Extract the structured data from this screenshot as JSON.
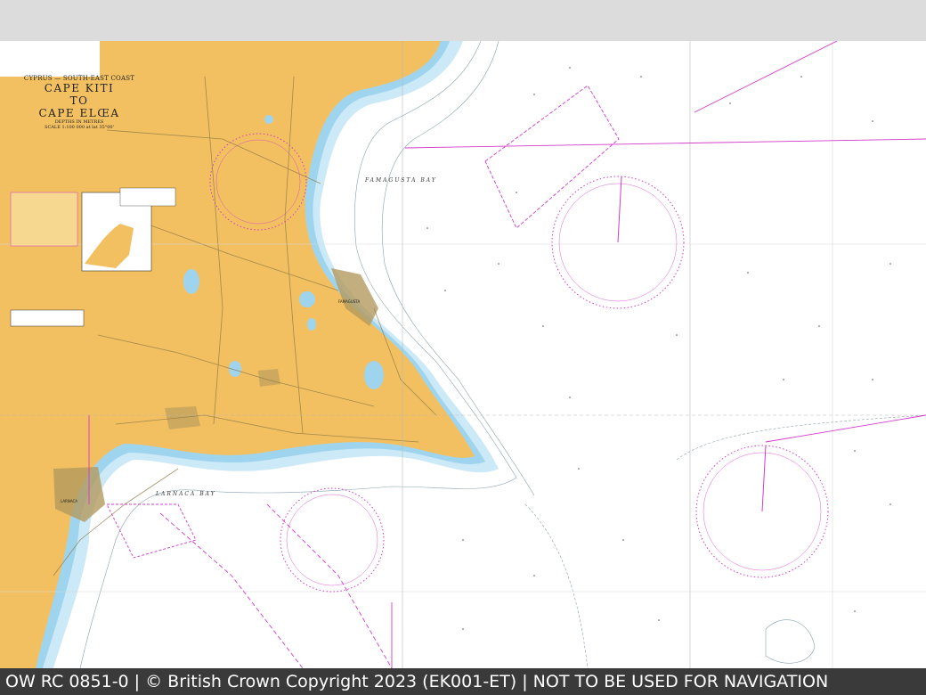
{
  "chart": {
    "region": "CYPRUS — SOUTH-EAST COAST",
    "title_line1": "CAPE KITI",
    "title_line2": "TO",
    "title_line3": "CAPE ELŒA",
    "depth_note": "DEPTHS IN METRES",
    "scale_note": "SCALE 1:100 000 at lat 35°00'"
  },
  "labels": {
    "famagusta_bay": "FAMAGUSTA  BAY",
    "larnaca_bay": "LARNACA  BAY",
    "famagusta": "FAMAGUSTA",
    "larnaca": "LARNACA"
  },
  "footer": {
    "text": "OW RC 0851-0 | © British Crown Copyright 2023 (EK001-ET) | NOT TO BE USED FOR NAVIGATION"
  },
  "colors": {
    "land": "#f2c060",
    "shallow": "#9fd4ef",
    "mid": "#cce9f7",
    "sea": "#ffffff",
    "magenta": "#d23cc8",
    "footer_bg": "#3a3a3a"
  }
}
